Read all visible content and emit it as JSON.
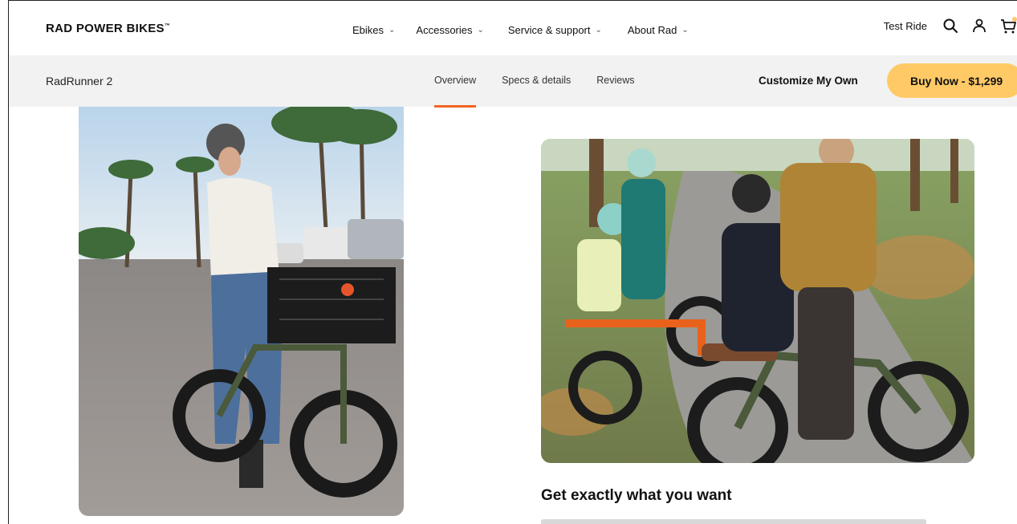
{
  "topnav": {
    "brand": "RAD POWER BIKES",
    "brand_mark": "™",
    "menu": [
      {
        "label": "Ebikes"
      },
      {
        "label": "Accessories"
      },
      {
        "label": "Service & support"
      },
      {
        "label": "About Rad"
      }
    ],
    "test_ride": "Test Ride",
    "icons": [
      "search-icon",
      "account-icon",
      "cart-icon"
    ]
  },
  "subnav": {
    "product_name": "RadRunner 2",
    "tabs": [
      {
        "label": "Overview",
        "active": true
      },
      {
        "label": "Specs & details",
        "active": false
      },
      {
        "label": "Reviews",
        "active": false
      }
    ],
    "customize_label": "Customize My Own",
    "buy_label": "Buy Now - $1,299"
  },
  "content": {
    "headline": "Get exactly what you want"
  },
  "colors": {
    "accent": "#f26522",
    "buy_button": "#ffc966",
    "subnav_bg": "#f2f2f2"
  }
}
